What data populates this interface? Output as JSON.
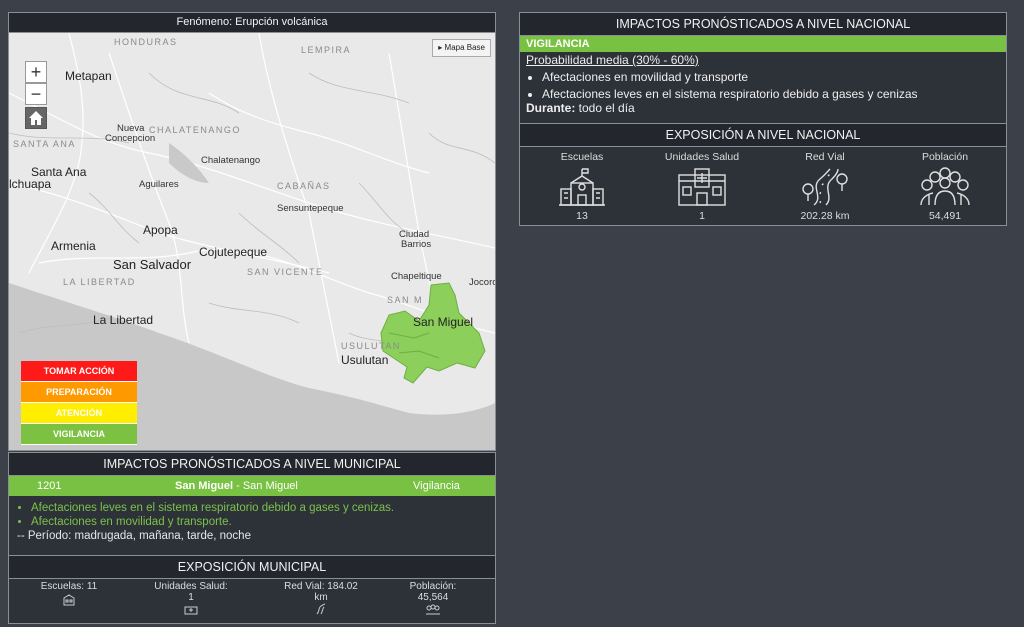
{
  "map": {
    "title": "Fenómeno: Erupción volcánica",
    "zoom_in": "+",
    "zoom_out": "−",
    "basemap_button": "Mapa Base",
    "labels": {
      "honduras": "HONDURAS",
      "lempira": "LEMPIRA",
      "metapan": "Metapan",
      "nueva_concepcion_1": "Nueva",
      "nueva_concepcion_2": "Concepcion",
      "chalatenango_dept": "CHALATENANGO",
      "santa_ana_dept": "SANTA ANA",
      "chalatenango": "Chalatenango",
      "santa_ana": "Santa Ana",
      "chuapa": "lchuapa",
      "aguilares": "Aguilares",
      "cabanas": "CABAÑAS",
      "sensuntepeque": "Sensuntepeque",
      "apopa": "Apopa",
      "ciudad_barrios_1": "Ciudad",
      "ciudad_barrios_2": "Barrios",
      "armenia": "Armenia",
      "cojutepeque": "Cojutepeque",
      "san_salvador": "San Salvador",
      "san_vicente": "SAN VICENTE",
      "chapeltique": "Chapeltique",
      "jocoro": "Jocoro",
      "la_libertad_dept": "LA LIBERTAD",
      "la_libertad": "La Libertad",
      "san_miguel": "San Miguel",
      "san_miguel_dept": "SAN M",
      "usulutan_dept": "USULUTAN",
      "usulutan": "Usulutan"
    },
    "legend": [
      {
        "label": "TOMAR ACCIÓN",
        "color": "#ff1a1a"
      },
      {
        "label": "PREPARACIÓN",
        "color": "#ff9900"
      },
      {
        "label": "ATENCIÓN",
        "color": "#ffee00"
      },
      {
        "label": "VIGILANCIA",
        "color": "#7cc142"
      }
    ],
    "affected_color": "#8ccf5b"
  },
  "municipal": {
    "title": "IMPACTOS PRONÓSTICADOS A NIVEL MUNICIPAL",
    "code": "1201",
    "municipality": "San Miguel",
    "department": " - San Miguel",
    "level": "Vigilancia",
    "impacts": [
      "Afectaciones leves en el sistema respiratorio debido a gases y cenizas.",
      "Afectaciones en movilidad y transporte."
    ],
    "period": "-- Período: madrugada, mañana, tarde, noche",
    "exposure_title": "EXPOSICIÓN MUNICIPAL",
    "exposure": [
      {
        "line1": "Escuelas: 11",
        "line2": "",
        "icon": "school-icon"
      },
      {
        "line1": "Unidades Salud:",
        "line2": "1",
        "icon": "hospital-icon"
      },
      {
        "line1": "Red Vial: 184.02",
        "line2": "km",
        "icon": "road-icon"
      },
      {
        "line1": "Población:",
        "line2": "45,564",
        "icon": "population-icon"
      }
    ]
  },
  "national": {
    "title": "IMPACTOS PRONÓSTICADOS A NIVEL NACIONAL",
    "level": "VIGILANCIA",
    "probability": "Probabilidad media (30% - 60%)",
    "impacts": [
      "Afectaciones en movilidad y transporte",
      "Afectaciones leves en el sistema respiratorio debido a gases y cenizas"
    ],
    "during_label": "Durante:",
    "during_value": " todo el día",
    "exposure_title": "EXPOSICIÓN A NIVEL NACIONAL",
    "exposure": [
      {
        "label": "Escuelas",
        "value": "13",
        "icon": "school-icon"
      },
      {
        "label": "Unidades Salud",
        "value": "1",
        "icon": "hospital-icon"
      },
      {
        "label": "Red Vial",
        "value": "202.28 km",
        "icon": "road-icon"
      },
      {
        "label": "Población",
        "value": "54,491",
        "icon": "population-icon"
      }
    ]
  }
}
